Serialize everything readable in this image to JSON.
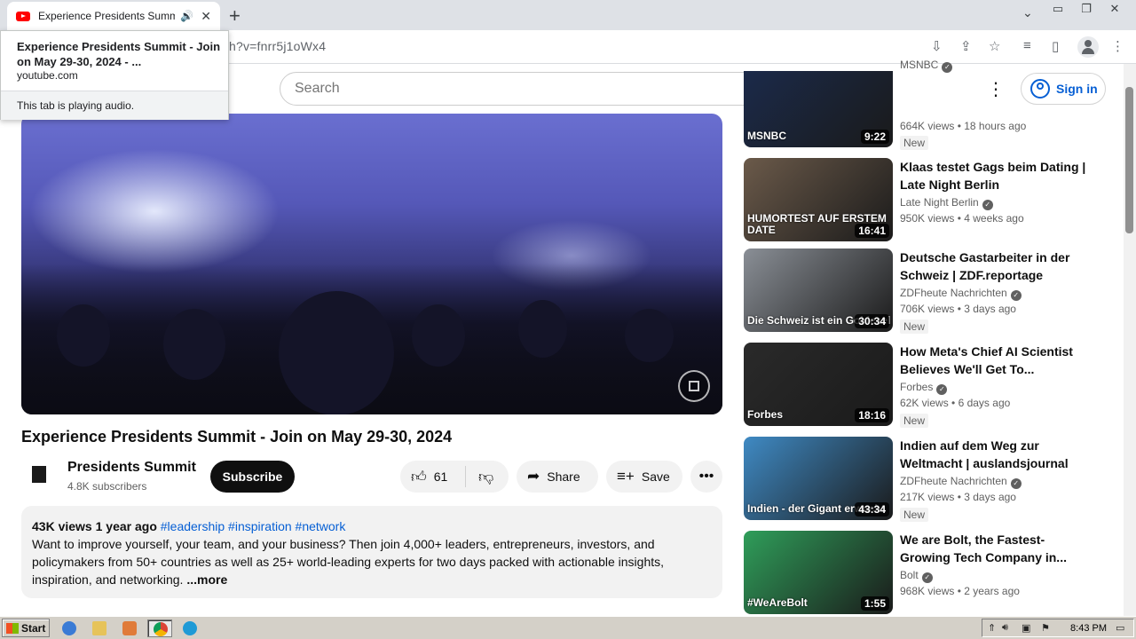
{
  "browser": {
    "tab_title": "Experience Presidents Summit -",
    "url_fragment": "h?v=fnrr5j1oWx4",
    "hovercard": {
      "title": "Experience Presidents Summit - Join on May 29-30, 2024 - ...",
      "domain": "youtube.com",
      "audio_note": "This tab is playing audio."
    }
  },
  "youtube": {
    "search_placeholder": "Search",
    "signin_label": "Sign in"
  },
  "video": {
    "title": "Experience Presidents Summit - Join on May 29-30, 2024",
    "channel": "Presidents Summit",
    "subscribers": "4.8K subscribers",
    "subscribe_label": "Subscribe",
    "likes": "61",
    "share_label": "Share",
    "save_label": "Save",
    "views": "43K views",
    "age": "1 year ago",
    "tags": "#leadership #inspiration #network",
    "description": "Want to improve yourself, your team, and your business? Then join 4,000+ leaders, entrepreneurs, investors, and policymakers from 50+ countries as well as 25+ world-leading experts for two days packed with actionable insights, inspiration, and networking.",
    "more_label": "...more"
  },
  "recommendations": [
    {
      "title": "",
      "channel": "MSNBC",
      "views": "664K views",
      "age": "18 hours ago",
      "badge": "New",
      "duration": "9:22",
      "thumb_text": "MSNBC",
      "color": "#1b2a4a"
    },
    {
      "title": "Klaas testet Gags beim Dating | Late Night Berlin",
      "channel": "Late Night Berlin",
      "views": "950K views",
      "age": "4 weeks ago",
      "badge": "",
      "duration": "16:41",
      "thumb_text": "HUMORTEST AUF ERSTEM DATE",
      "color": "#6b5a4a"
    },
    {
      "title": "Deutsche Gastarbeiter in der Schweiz | ZDF.reportage",
      "channel": "ZDFheute Nachrichten",
      "views": "706K views",
      "age": "3 days ago",
      "badge": "New",
      "duration": "30:34",
      "thumb_text": "Die Schweiz ist ein Goldesel",
      "color": "#8a8f96"
    },
    {
      "title": "How Meta's Chief AI Scientist Believes We'll Get To...",
      "channel": "Forbes",
      "views": "62K views",
      "age": "6 days ago",
      "badge": "New",
      "duration": "18:16",
      "thumb_text": "Forbes",
      "color": "#2a2a2a"
    },
    {
      "title": "Indien auf dem Weg zur Weltmacht | auslandsjournal",
      "channel": "ZDFheute Nachrichten",
      "views": "217K views",
      "age": "3 days ago",
      "badge": "New",
      "duration": "43:34",
      "thumb_text": "Indien - der Gigant erwacht",
      "color": "#3f8ac4"
    },
    {
      "title": "We are Bolt, the Fastest-Growing Tech Company in...",
      "channel": "Bolt",
      "views": "968K views",
      "age": "2 years ago",
      "badge": "",
      "duration": "1:55",
      "thumb_text": "#WeAreBolt",
      "color": "#2f9e5a"
    }
  ],
  "taskbar": {
    "start_label": "Start",
    "clock": "8:43 PM"
  }
}
